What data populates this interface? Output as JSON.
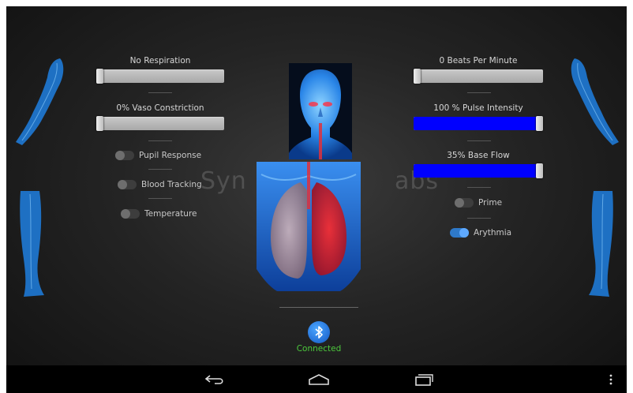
{
  "left_controls": {
    "respiration_label": "No Respiration",
    "respiration_level": 0,
    "vaso_label": "0% Vaso Constriction",
    "vaso_level": 0,
    "toggles": [
      {
        "label": "Pupil Response",
        "on": false
      },
      {
        "label": "Blood Tracking",
        "on": false
      },
      {
        "label": "Temperature",
        "on": false
      }
    ]
  },
  "right_controls": {
    "heart_rate_label": "0 Beats Per Minute",
    "heart_rate_level": 0,
    "pulse_label": "100 % Pulse Intensity",
    "pulse_level": 1.0,
    "base_flow_label": "35% Base Flow",
    "base_flow_level": 1.0,
    "toggles": [
      {
        "label": "Prime",
        "on": false
      },
      {
        "label": "Arythmia",
        "on": true
      }
    ]
  },
  "watermark": {
    "left": "Syn",
    "right": "abs"
  },
  "connection": {
    "status": "Connected",
    "icon": "bluetooth-icon"
  },
  "nav_icons": [
    "back-icon",
    "home-icon",
    "recent-apps-icon",
    "overflow-menu-icon"
  ],
  "colors": {
    "slider_fill": "#0000ff",
    "connected": "#4cc93c",
    "toggle_on": "#2e79c9",
    "body_blue": "#1e6fd9"
  }
}
